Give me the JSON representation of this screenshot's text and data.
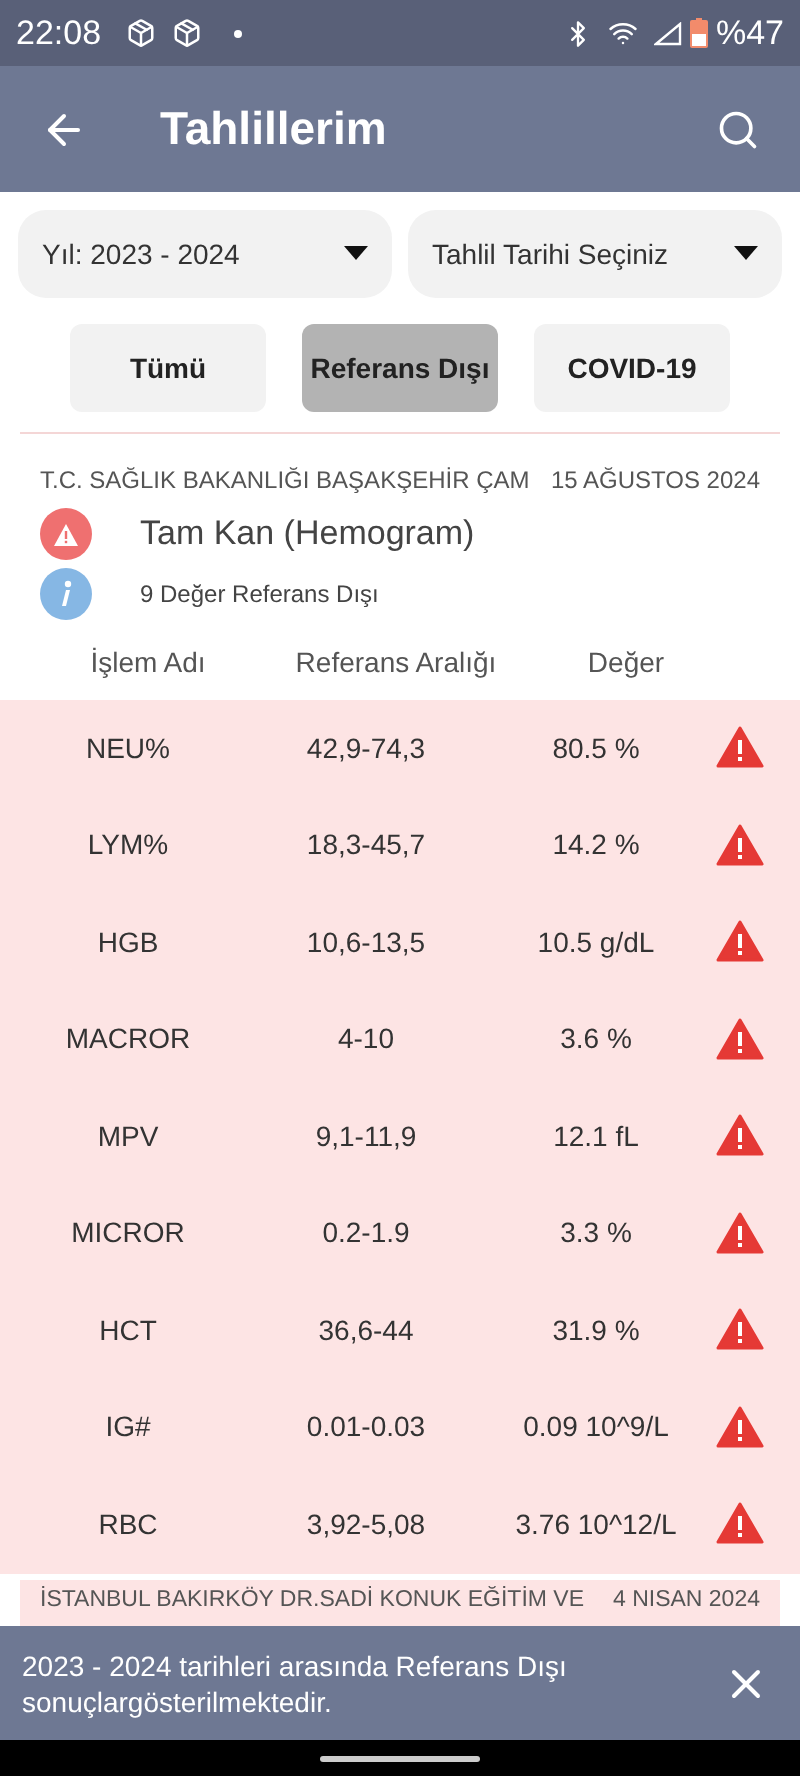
{
  "status_bar": {
    "time": "22:08",
    "battery": "%47"
  },
  "app_bar": {
    "title": "Tahlillerim"
  },
  "filters": [
    {
      "label": "Yıl: 2023 - 2024"
    },
    {
      "label": "Tahlil Tarihi Seçiniz"
    }
  ],
  "chips": [
    {
      "label": "Tümü",
      "selected": false
    },
    {
      "label": "Referans Dışı",
      "selected": true
    },
    {
      "label": "COVID-19",
      "selected": false
    }
  ],
  "report": {
    "hospital": "T.C. SAĞLIK BAKANLIĞI BAŞAKŞEHİR ÇAM",
    "date": "15 AĞUSTOS 2024",
    "test_name": "Tam Kan (Hemogram)",
    "summary": "9 Değer Referans Dışı",
    "columns": [
      "İşlem Adı",
      "Referans Aralığı",
      "Değer"
    ],
    "rows": [
      {
        "name": "NEU%",
        "range": "42,9-74,3",
        "value": "80.5 %",
        "out_of_range": true
      },
      {
        "name": "LYM%",
        "range": "18,3-45,7",
        "value": "14.2 %",
        "out_of_range": true
      },
      {
        "name": "HGB",
        "range": "10,6-13,5",
        "value": "10.5 g/dL",
        "out_of_range": true
      },
      {
        "name": "MACROR",
        "range": "4-10",
        "value": "3.6 %",
        "out_of_range": true
      },
      {
        "name": "MPV",
        "range": "9,1-11,9",
        "value": "12.1 fL",
        "out_of_range": true
      },
      {
        "name": "MICROR",
        "range": "0.2-1.9",
        "value": "3.3 %",
        "out_of_range": true
      },
      {
        "name": "HCT",
        "range": "36,6-44",
        "value": "31.9 %",
        "out_of_range": true
      },
      {
        "name": "IG#",
        "range": "0.01-0.03",
        "value": "0.09 10^9/L",
        "out_of_range": true
      },
      {
        "name": "RBC",
        "range": "3,92-5,08",
        "value": "3.76 10^12/L",
        "out_of_range": true
      }
    ]
  },
  "next_report": {
    "hospital": "İSTANBUL BAKIRKÖY DR.SADİ KONUK EĞİTİM VE",
    "date": "4 NISAN 2024"
  },
  "snackbar": {
    "message": "2023 - 2024 tarihleri arasında Referans Dışı sonuçlargösterilmektedir."
  }
}
